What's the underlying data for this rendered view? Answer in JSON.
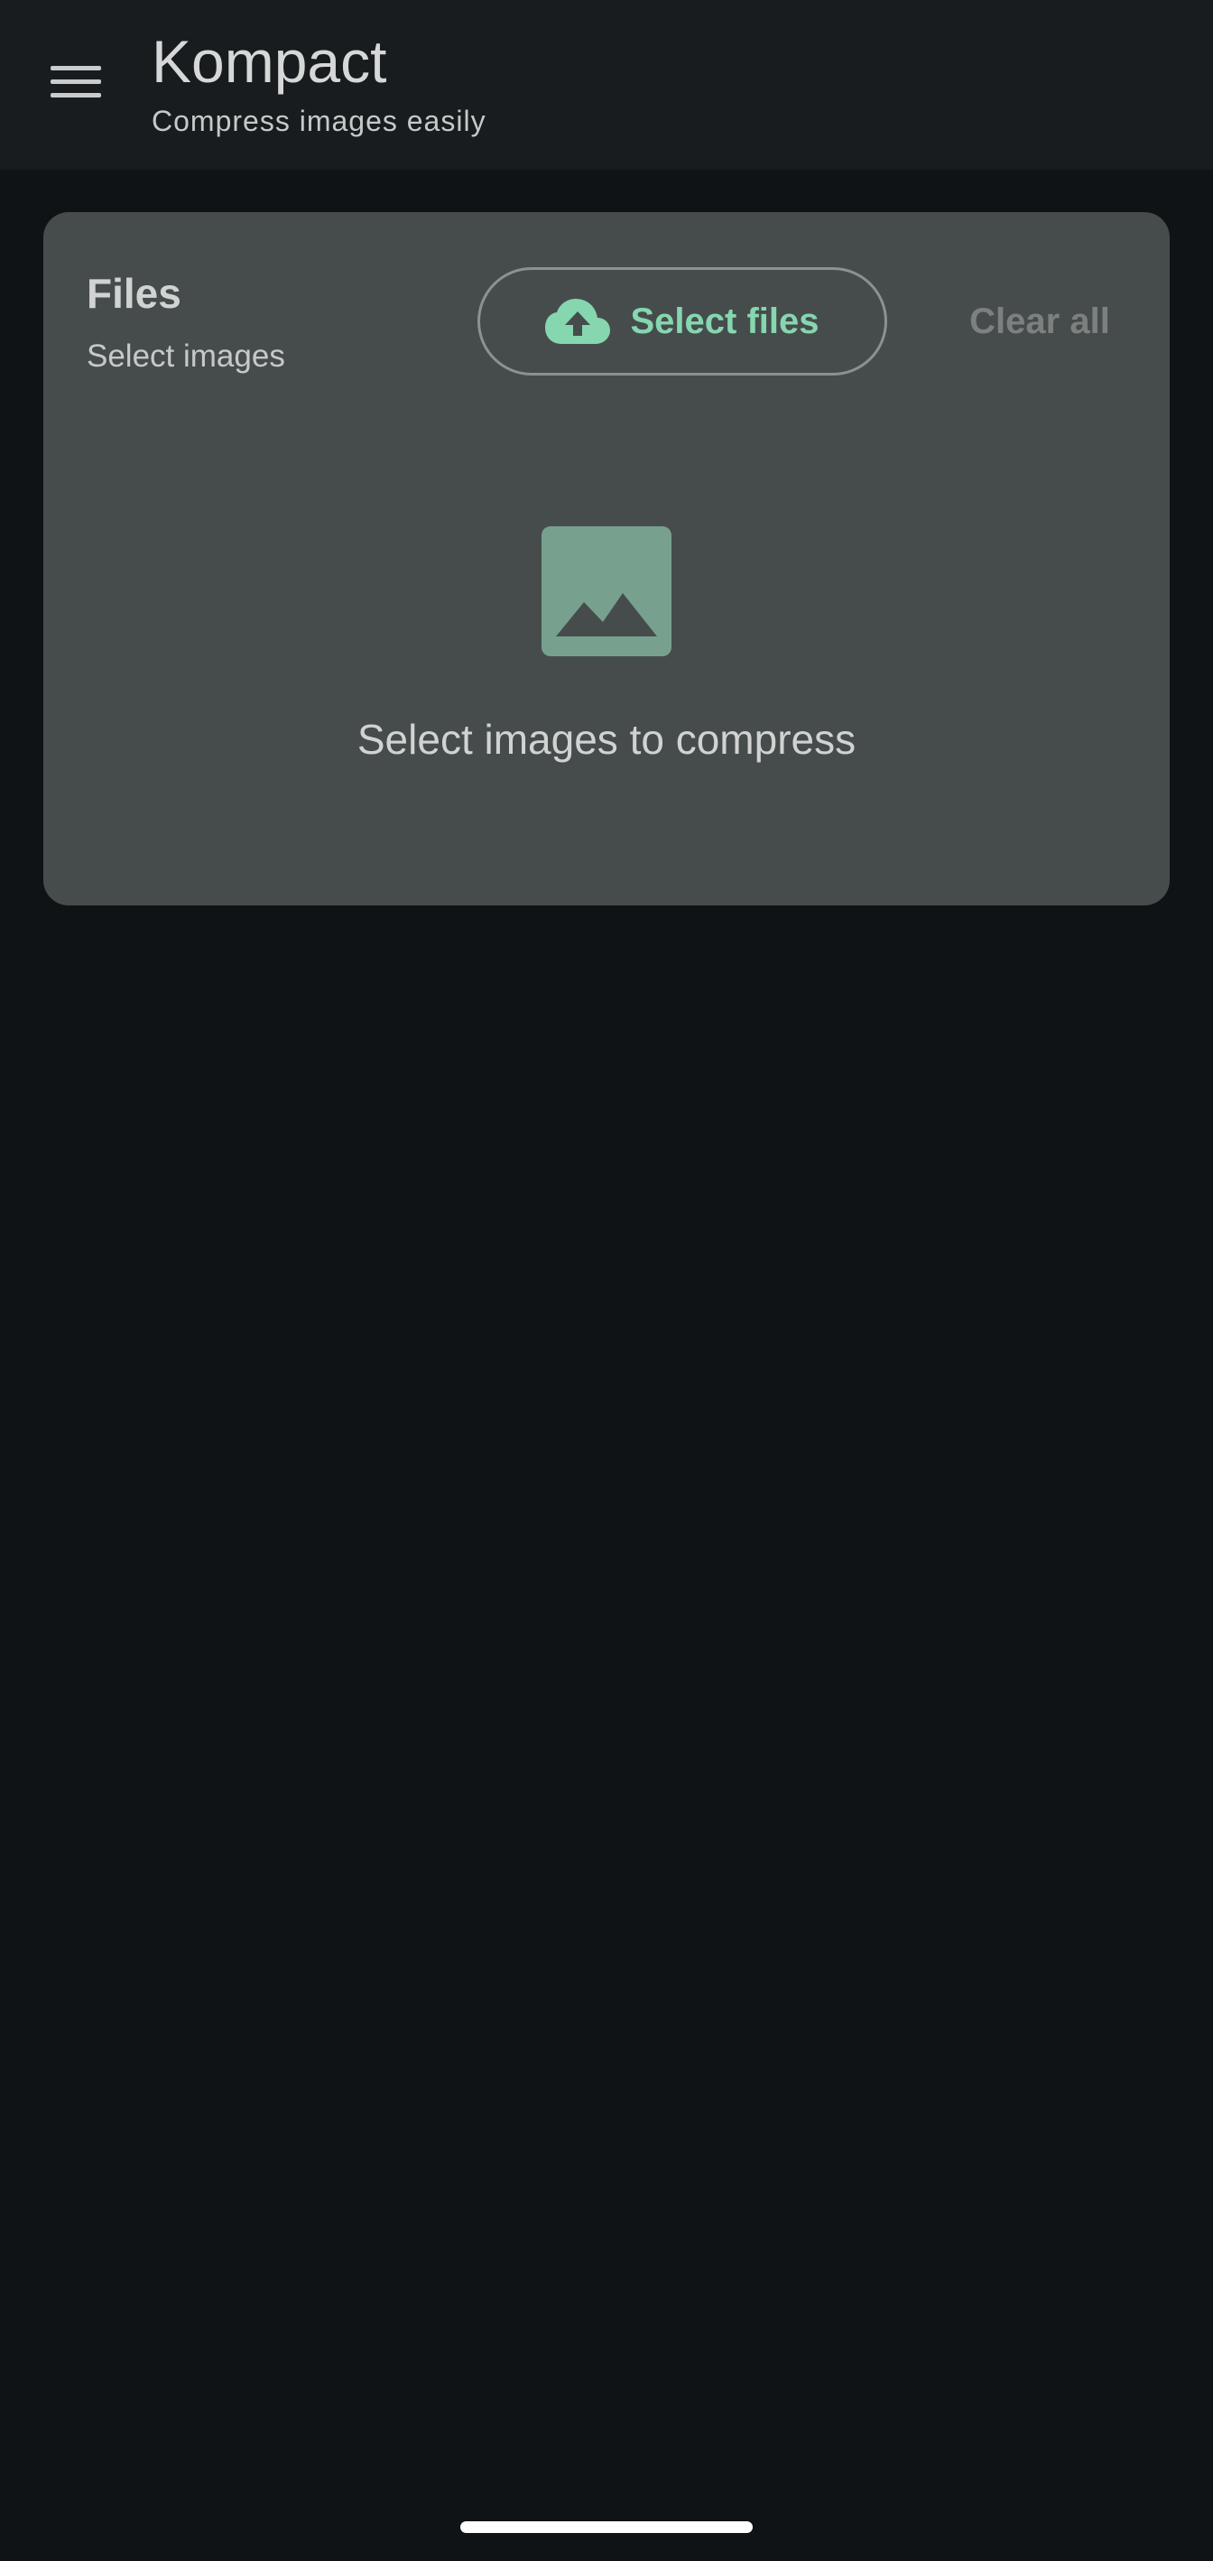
{
  "colors": {
    "background": "#0f1316",
    "app_bar": "#181c1e",
    "card": "#464c4c",
    "accent": "#86d6b0",
    "image_placeholder": "#77a18e",
    "muted_text": "#7c8180"
  },
  "app_bar": {
    "menu_icon": "hamburger-menu-icon",
    "title": "Kompact",
    "subtitle": "Compress images easily"
  },
  "files_card": {
    "title": "Files",
    "subtitle": "Select images",
    "select_button": {
      "icon": "cloud-upload-icon",
      "label": "Select files"
    },
    "clear_button": {
      "label": "Clear all",
      "enabled": false
    },
    "empty_state": {
      "icon": "image-icon",
      "text": "Select images to compress"
    }
  },
  "system": {
    "home_indicator": "gesture-bar"
  }
}
